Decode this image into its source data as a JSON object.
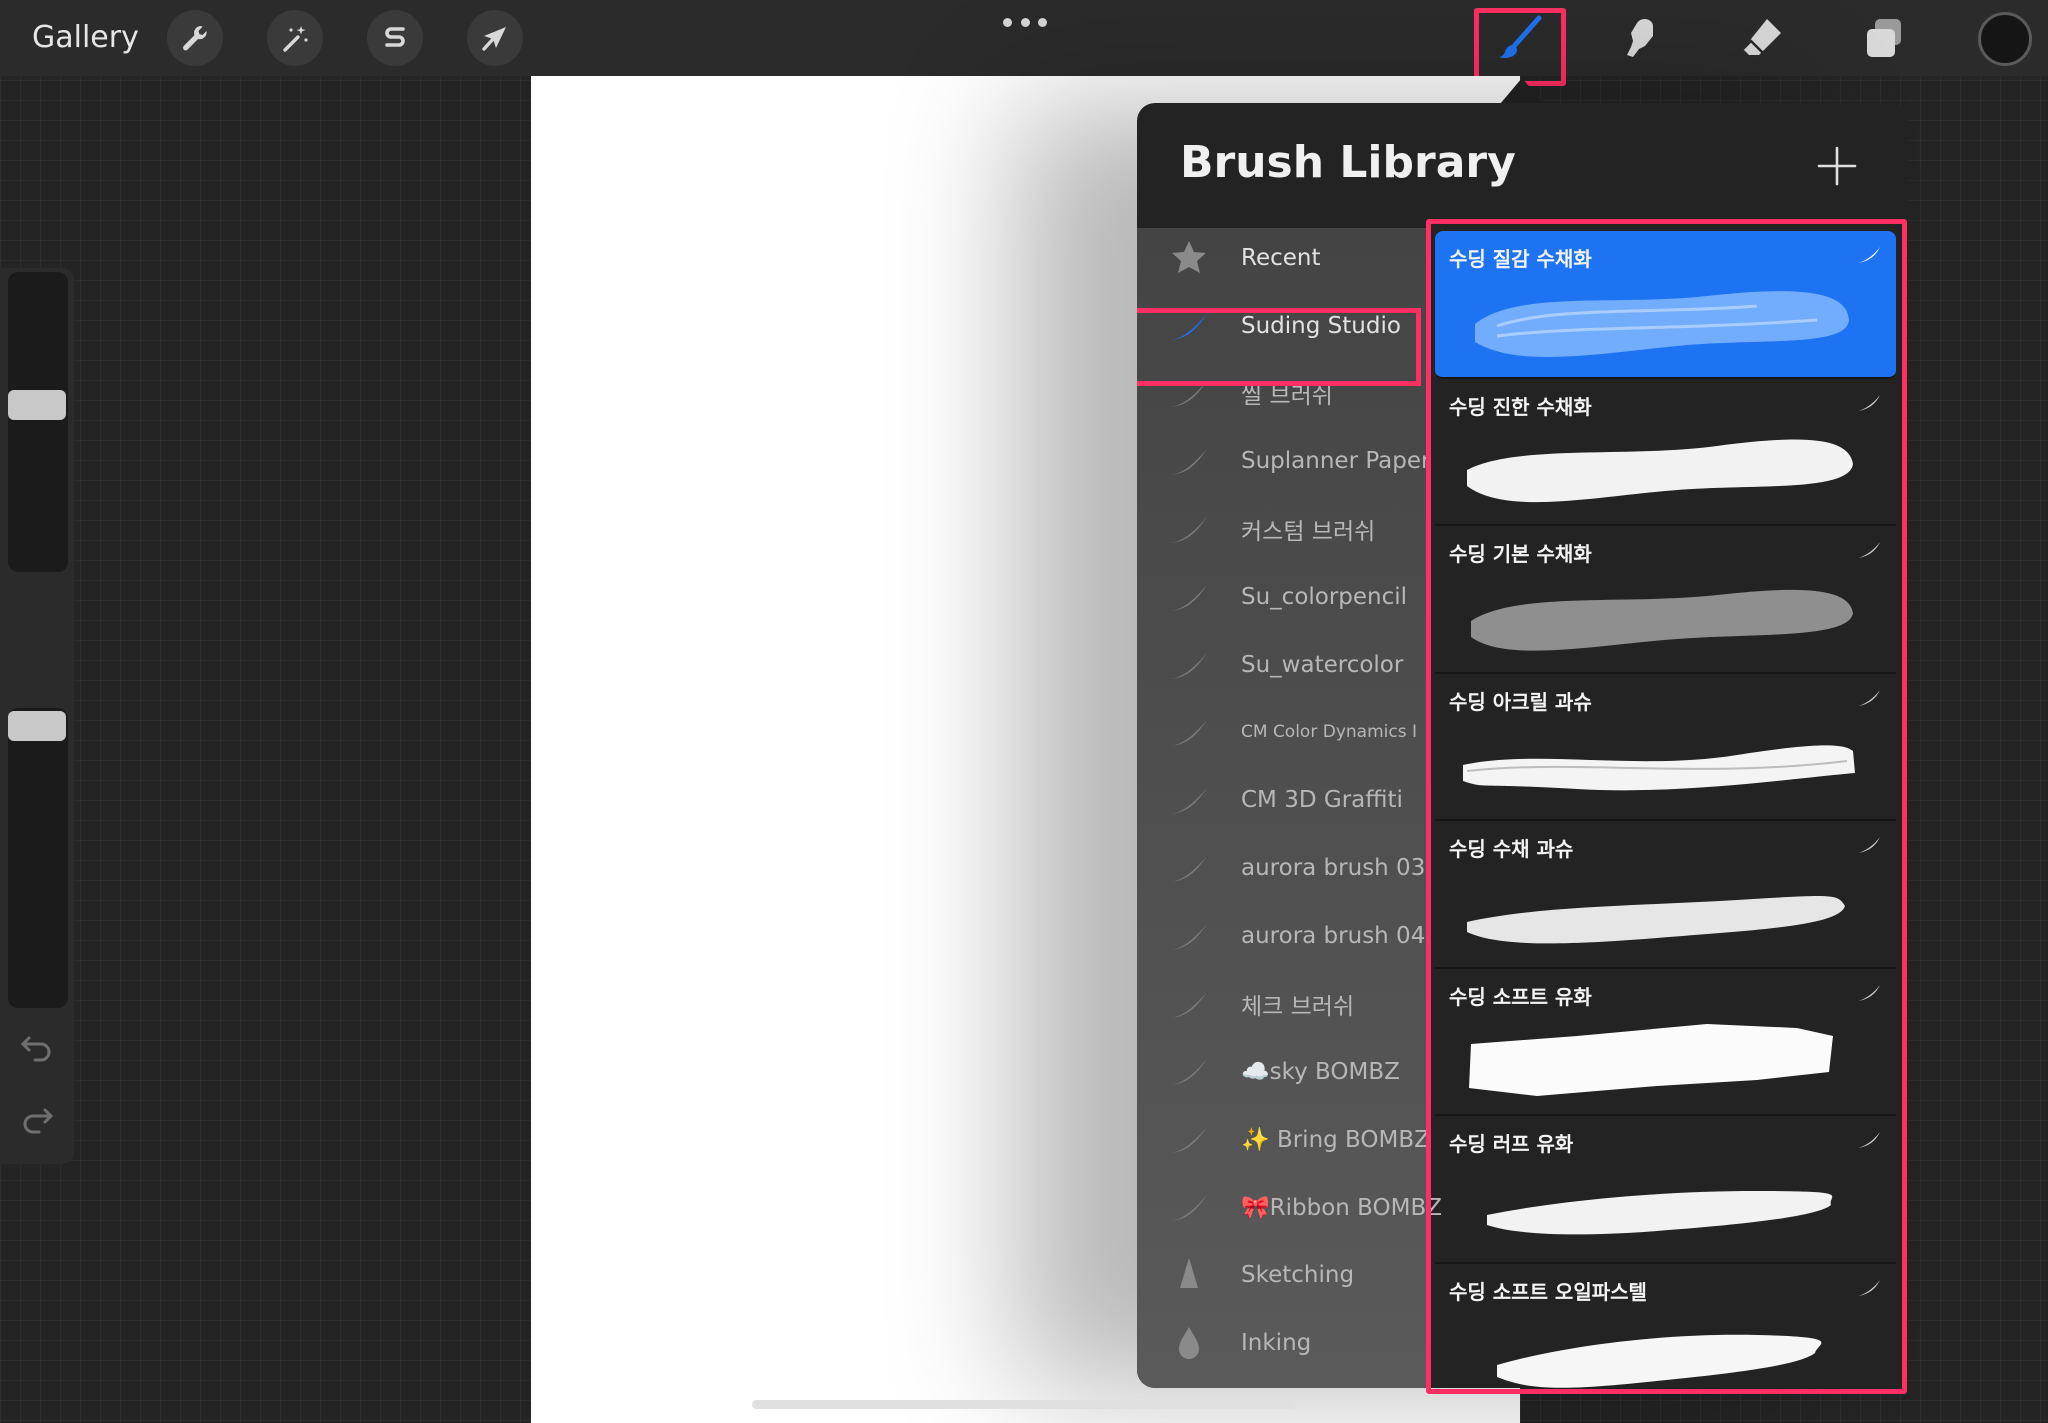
{
  "toolbar": {
    "gallery_label": "Gallery",
    "left_tools": [
      "wrench-icon",
      "magic-wand-icon",
      "selection-s-icon",
      "arrow-cursor-icon"
    ],
    "right_tools": [
      "brush-icon",
      "smudge-icon",
      "eraser-icon",
      "layers-icon",
      "color-swatch"
    ],
    "active_tool": "brush",
    "accent_color": "#1d73f2",
    "highlight_color": "#ff2e63"
  },
  "library": {
    "title": "Brush Library",
    "sets": [
      {
        "label": "Recent",
        "icon": "star-icon"
      },
      {
        "label": "Suding Studio",
        "icon": "brush-stroke-icon",
        "selected": true
      },
      {
        "label": "씰 브러쉬",
        "icon": "brush-stroke-icon"
      },
      {
        "label": "Suplanner Paper",
        "icon": "brush-stroke-icon"
      },
      {
        "label": "커스텀 브러쉬",
        "icon": "brush-stroke-icon"
      },
      {
        "label": "Su_colorpencil",
        "icon": "brush-stroke-icon"
      },
      {
        "label": "Su_watercolor",
        "icon": "brush-stroke-icon"
      },
      {
        "label": "CM Color Dynamics I",
        "icon": "brush-stroke-icon"
      },
      {
        "label": "CM 3D Graffiti",
        "icon": "brush-stroke-icon"
      },
      {
        "label": "aurora brush 03",
        "icon": "brush-stroke-icon"
      },
      {
        "label": "aurora brush 04",
        "icon": "brush-stroke-icon"
      },
      {
        "label": "체크 브러쉬",
        "icon": "brush-stroke-icon"
      },
      {
        "label": "☁️sky BOMBZ",
        "icon": "brush-stroke-icon"
      },
      {
        "label": "✨ Bring BOMBZ",
        "icon": "brush-stroke-icon"
      },
      {
        "label": "🎀Ribbon BOMBZ",
        "icon": "brush-stroke-icon"
      },
      {
        "label": "Sketching",
        "icon": "pencil-tip-icon"
      },
      {
        "label": "Inking",
        "icon": "ink-drop-icon"
      }
    ],
    "brushes": [
      {
        "name": "수딩 질감 수채화",
        "selected": true
      },
      {
        "name": "수딩 진한 수채화"
      },
      {
        "name": "수딩 기본 수채화"
      },
      {
        "name": "수딩 아크릴 과슈"
      },
      {
        "name": "수딩 수채 과슈"
      },
      {
        "name": "수딩 소프트 유화"
      },
      {
        "name": "수딩 러프 유화"
      },
      {
        "name": "수딩 소프트 오일파스텔"
      }
    ]
  }
}
